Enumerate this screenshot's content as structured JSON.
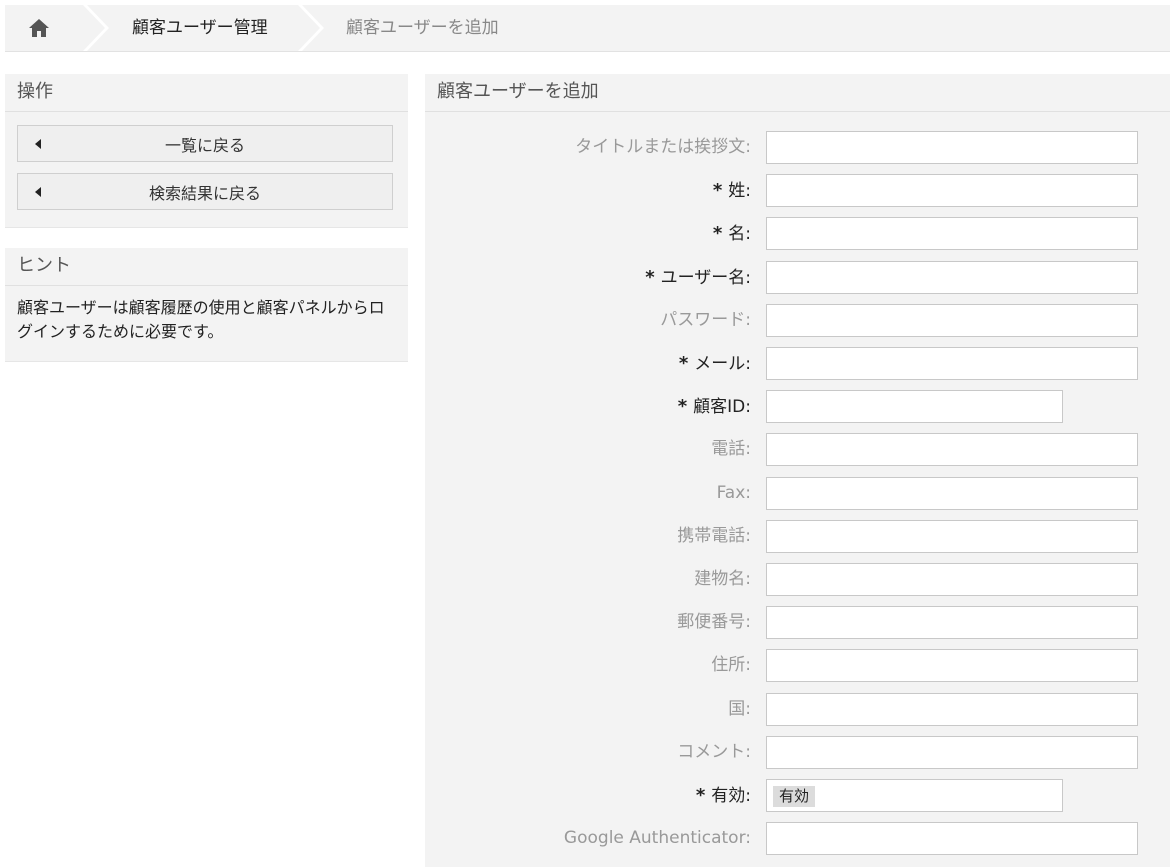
{
  "breadcrumb": {
    "home_icon": "home-icon",
    "items": [
      "顧客ユーザー管理",
      "顧客ユーザーを追加"
    ]
  },
  "sidebar": {
    "actions": {
      "title": "操作",
      "buttons": [
        "一覧に戻る",
        "検索結果に戻る"
      ]
    },
    "hint": {
      "title": "ヒント",
      "text": "顧客ユーザーは顧客履歴の使用と顧客パネルからログインするために必要です。"
    }
  },
  "form": {
    "title": "顧客ユーザーを追加",
    "required_marker": "*",
    "fields": [
      {
        "label": "タイトルまたは挨拶文:",
        "required": false,
        "value": ""
      },
      {
        "label": "姓:",
        "required": true,
        "value": ""
      },
      {
        "label": "名:",
        "required": true,
        "value": ""
      },
      {
        "label": "ユーザー名:",
        "required": true,
        "value": ""
      },
      {
        "label": "パスワード:",
        "required": false,
        "value": ""
      },
      {
        "label": "メール:",
        "required": true,
        "value": ""
      },
      {
        "label": "顧客ID:",
        "required": true,
        "value": ""
      },
      {
        "label": "電話:",
        "required": false,
        "value": ""
      },
      {
        "label": "Fax:",
        "required": false,
        "value": ""
      },
      {
        "label": "携帯電話:",
        "required": false,
        "value": ""
      },
      {
        "label": "建物名:",
        "required": false,
        "value": ""
      },
      {
        "label": "郵便番号:",
        "required": false,
        "value": ""
      },
      {
        "label": "住所:",
        "required": false,
        "value": ""
      },
      {
        "label": "国:",
        "required": false,
        "value": ""
      },
      {
        "label": "コメント:",
        "required": false,
        "value": ""
      },
      {
        "label": "有効:",
        "required": true,
        "value": "有効"
      },
      {
        "label": "Google Authenticator:",
        "required": false,
        "value": ""
      }
    ]
  }
}
